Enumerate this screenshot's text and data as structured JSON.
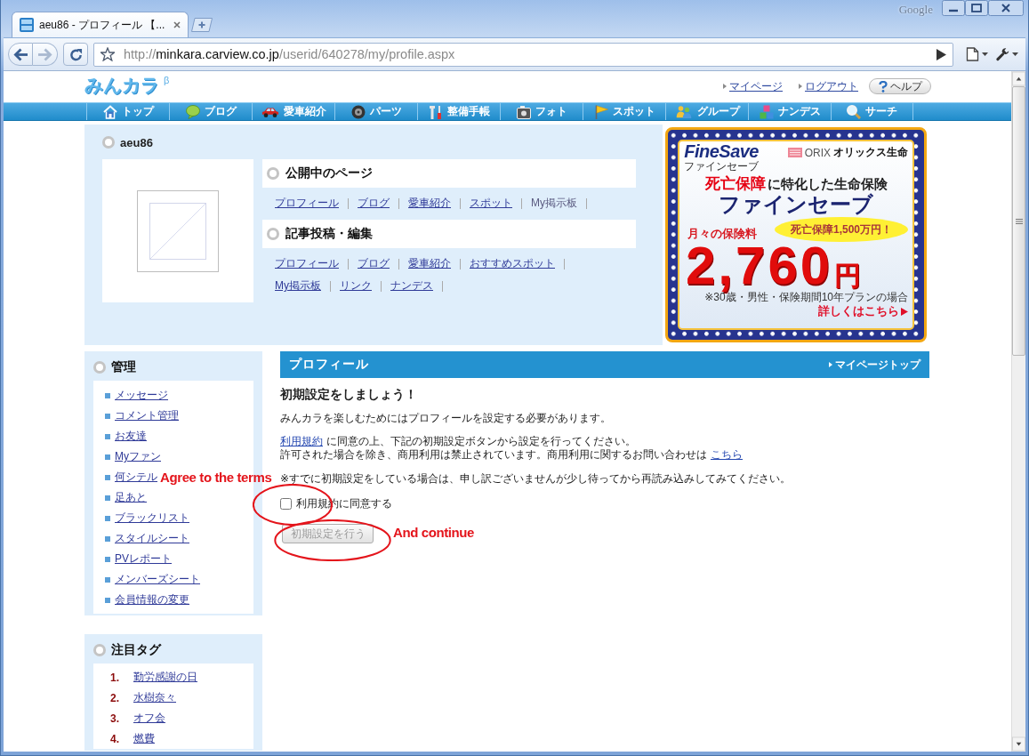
{
  "tabs": [
    {
      "title": "aeu86 - プロフィール 【...",
      "selected": true
    }
  ],
  "title_bar": {
    "brand": "Google"
  },
  "toolbar": {
    "buttons": [
      {
        "kind": "back",
        "disabled": false
      },
      {
        "kind": "forward",
        "disabled": true
      },
      {
        "kind": "reload",
        "disabled": false
      }
    ],
    "address": {
      "scheme": "http://",
      "host": "minkara.carview.co.jp",
      "path": "/userid/640278/my/profile.aspx"
    }
  },
  "page": {
    "logo": {
      "text": "みんカラ",
      "mark": "β"
    },
    "header_links": [
      {
        "label": "マイページ"
      },
      {
        "label": "ログアウト"
      }
    ],
    "help_button": {
      "label": "ヘルプ"
    },
    "nav": [
      {
        "kind": "home",
        "label": "トップ"
      },
      {
        "kind": "blog",
        "label": "ブログ"
      },
      {
        "kind": "car",
        "label": "愛車紹介"
      },
      {
        "kind": "parts",
        "label": "パーツ"
      },
      {
        "kind": "maintenance",
        "label": "整備手帳"
      },
      {
        "kind": "photo",
        "label": "フォト"
      },
      {
        "kind": "spot",
        "label": "スポット"
      },
      {
        "kind": "group",
        "label": "グループ"
      },
      {
        "kind": "nandesu",
        "label": "ナンデス"
      },
      {
        "kind": "search",
        "label": "サーチ"
      }
    ],
    "profile": {
      "username": "aeu86",
      "sections": [
        {
          "title": "公開中のページ",
          "links": [
            {
              "label": "プロフィール",
              "disabled": false
            },
            {
              "label": "ブログ",
              "disabled": false
            },
            {
              "label": "愛車紹介",
              "disabled": false
            },
            {
              "label": "スポット",
              "disabled": false
            },
            {
              "label": "My掲示板",
              "disabled": true
            }
          ]
        },
        {
          "title": "記事投稿・編集",
          "links": [
            {
              "label": "プロフィール",
              "disabled": false
            },
            {
              "label": "ブログ",
              "disabled": false
            },
            {
              "label": "愛車紹介",
              "disabled": false
            },
            {
              "label": "おすすめスポット",
              "disabled": false
            },
            {
              "label": "My掲示板",
              "disabled": false
            },
            {
              "label": "リンク",
              "disabled": false
            },
            {
              "label": "ナンデス",
              "disabled": false
            }
          ]
        }
      ]
    },
    "ad": {
      "brand": "FineSave",
      "brand_reading": "ファインセーブ",
      "company_mark": "ORIX",
      "company": "オリックス生命",
      "headline_emphasis": "死亡保障",
      "headline": "に特化した生命保険",
      "product": "ファインセーブ",
      "bubble": "死亡保障1,500万円！",
      "price_label": "月々の保険料",
      "price": "2,760",
      "currency": "円",
      "fine_print": "※30歳・男性・保険期間10年プランの場合",
      "cta": "詳しくはこちら"
    },
    "sidebar": [
      {
        "kind": "menu",
        "title": "管理",
        "items": [
          {
            "label": "メッセージ"
          },
          {
            "label": "コメント管理"
          },
          {
            "label": "お友達"
          },
          {
            "label": "Myファン"
          },
          {
            "label": "何シテル"
          },
          {
            "label": "足あと"
          },
          {
            "label": "ブラックリスト"
          },
          {
            "label": "スタイルシート"
          },
          {
            "label": "PVレポート"
          },
          {
            "label": "メンバーズシート"
          },
          {
            "label": "会員情報の変更"
          }
        ]
      },
      {
        "kind": "ranking",
        "title": "注目タグ",
        "items": [
          {
            "rank": "1.",
            "label": "勤労感謝の日"
          },
          {
            "rank": "2.",
            "label": "水樹奈々"
          },
          {
            "rank": "3.",
            "label": "オフ会"
          },
          {
            "rank": "4.",
            "label": "燃費"
          }
        ]
      }
    ],
    "main": {
      "title": "プロフィール",
      "top_link": "マイページトップ",
      "heading": "初期設定をしましょう！",
      "intro": "みんカラを楽しむためにはプロフィールを設定する必要があります。",
      "terms_lines": [
        [
          {
            "kind": "link",
            "text": "利用規約"
          },
          {
            "kind": "text",
            "text": "に同意の上、下記の初期設定ボタンから設定を行ってください。"
          }
        ],
        [
          {
            "kind": "text",
            "text": "許可された場合を除き、商用利用は禁止されています。商用利用に関するお問い合わせは"
          },
          {
            "kind": "link",
            "text": "こちら"
          }
        ]
      ],
      "note": "※すでに初期設定をしている場合は、申し訳ございませんが少し待ってから再読み込みしてみてください。",
      "agree": {
        "label": "利用規約に同意する",
        "checked": false
      },
      "submit": {
        "label": "初期設定を行う",
        "disabled": true
      }
    }
  },
  "annotations": [
    {
      "kind": "label",
      "text": "Agree to the terms"
    },
    {
      "kind": "ellipse"
    },
    {
      "kind": "label",
      "text": "And continue"
    },
    {
      "kind": "ellipse"
    }
  ]
}
